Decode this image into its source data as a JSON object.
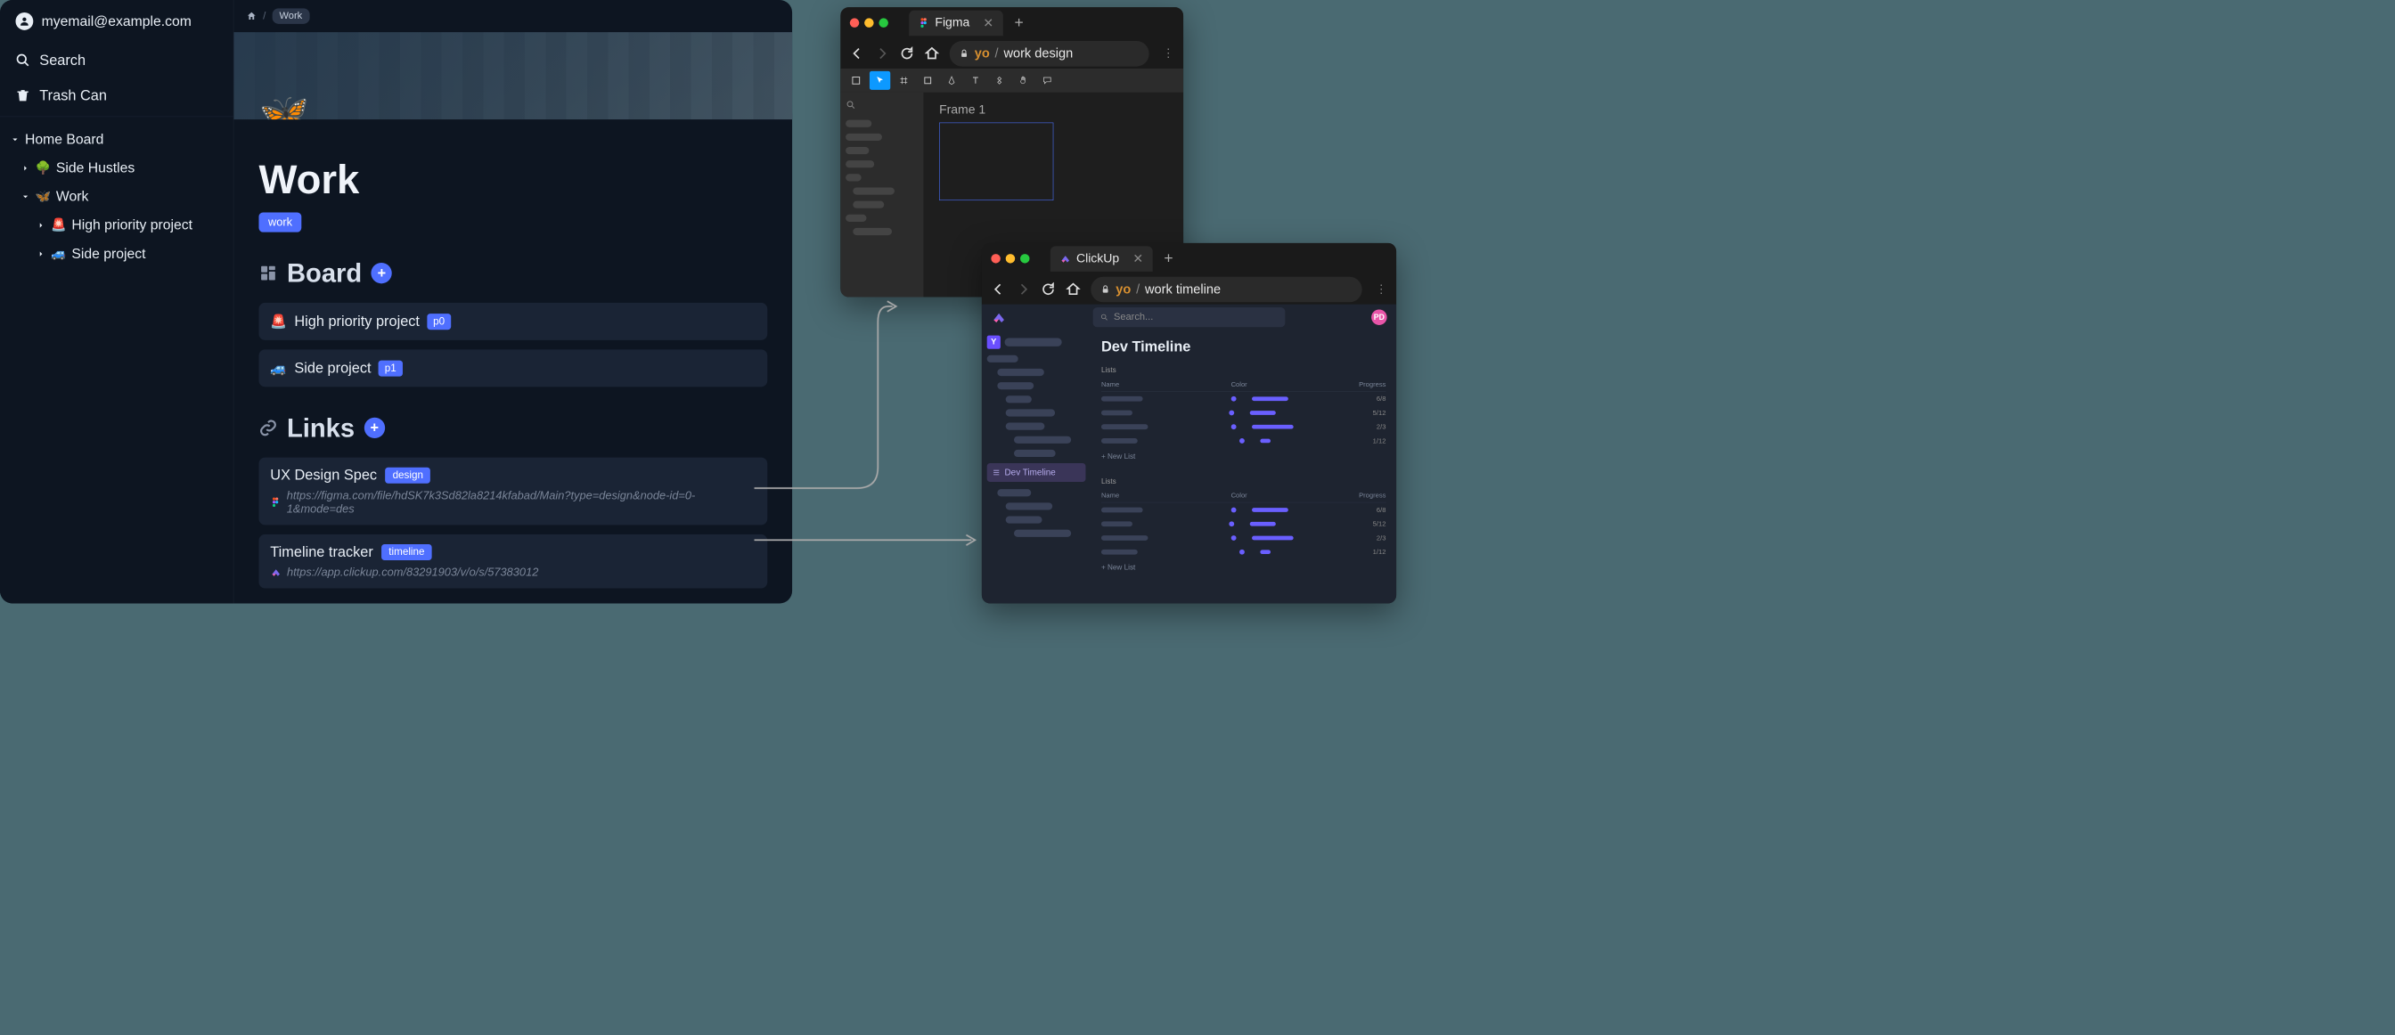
{
  "user_email": "myemail@example.com",
  "sidebar": {
    "search_label": "Search",
    "trash_label": "Trash Can"
  },
  "tree": {
    "root": "Home Board",
    "items": [
      {
        "emoji": "🌳",
        "label": "Side Hustles",
        "expanded": false
      },
      {
        "emoji": "🦋",
        "label": "Work",
        "expanded": true,
        "children": [
          {
            "emoji": "🚨",
            "label": "High priority project"
          },
          {
            "emoji": "🚙",
            "label": "Side project"
          }
        ]
      }
    ]
  },
  "breadcrumb": {
    "current": "Work"
  },
  "page": {
    "emoji": "🦋",
    "title": "Work",
    "tag": "work"
  },
  "board": {
    "heading": "Board",
    "items": [
      {
        "emoji": "🚨",
        "title": "High priority project",
        "priority": "p0"
      },
      {
        "emoji": "🚙",
        "title": "Side project",
        "priority": "p1"
      }
    ]
  },
  "links": {
    "heading": "Links",
    "items": [
      {
        "title": "UX Design Spec",
        "tag": "design",
        "url": "https://figma.com/file/hdSK7k3Sd82la8214kfabad/Main?type=design&node-id=0-1&mode=des",
        "favicon": "figma"
      },
      {
        "title": "Timeline tracker",
        "tag": "timeline",
        "url": "https://app.clickup.com/83291903/v/o/s/57383012",
        "favicon": "clickup"
      }
    ]
  },
  "figma_window": {
    "tab_title": "Figma",
    "url_proto": "yo",
    "url_path": "work design",
    "frame_label": "Frame 1"
  },
  "clickup_window": {
    "tab_title": "ClickUp",
    "url_proto": "yo",
    "url_path": "work timeline",
    "search_placeholder": "Search...",
    "avatar": "PD",
    "workspace_letter": "Y",
    "selected_item": "Dev Timeline",
    "content_title": "Dev Timeline",
    "lists_label": "Lists",
    "columns": {
      "name": "Name",
      "color": "Color",
      "progress": "Progress"
    },
    "lists": [
      {
        "progress": 60,
        "fraction": "6/8"
      },
      {
        "progress": 42,
        "fraction": "5/12"
      },
      {
        "progress": 70,
        "fraction": "2/3"
      },
      {
        "progress": 10,
        "fraction": "1/12"
      }
    ],
    "new_list_label": "+   New List"
  }
}
